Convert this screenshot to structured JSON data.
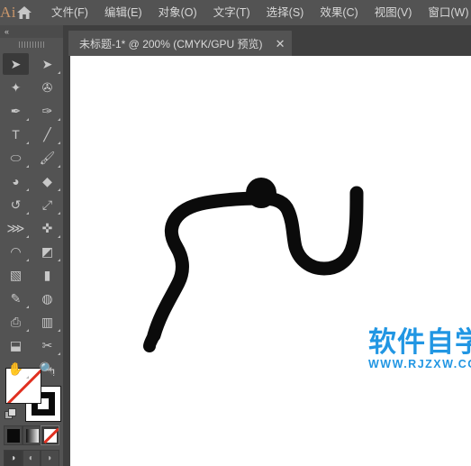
{
  "app": {
    "logo": "Ai",
    "home_icon": "home-icon"
  },
  "menubar": {
    "items": [
      {
        "label": "文件(F)",
        "name": "menu-file"
      },
      {
        "label": "编辑(E)",
        "name": "menu-edit"
      },
      {
        "label": "对象(O)",
        "name": "menu-object"
      },
      {
        "label": "文字(T)",
        "name": "menu-type"
      },
      {
        "label": "选择(S)",
        "name": "menu-select"
      },
      {
        "label": "效果(C)",
        "name": "menu-effect"
      },
      {
        "label": "视图(V)",
        "name": "menu-view"
      },
      {
        "label": "窗口(W)",
        "name": "menu-window"
      }
    ]
  },
  "tabbar": {
    "document_tab": {
      "label": "未标题-1* @ 200% (CMYK/GPU 预览)",
      "close_label": "✕",
      "title": "未标题-1",
      "modified": "*",
      "zoom": "200%",
      "color_mode": "CMYK",
      "preview_mode": "GPU 预览"
    }
  },
  "toolpanel": {
    "collapse_label": "«",
    "grip": "drag-grip",
    "tools": [
      {
        "name": "selection-tool",
        "glyph": "➤",
        "active": true,
        "corner": false
      },
      {
        "name": "direct-selection-tool",
        "glyph": "➤",
        "active": false,
        "corner": true
      },
      {
        "name": "magic-wand-tool",
        "glyph": "✦",
        "active": false,
        "corner": false
      },
      {
        "name": "lasso-tool",
        "glyph": "✇",
        "active": false,
        "corner": false
      },
      {
        "name": "pen-tool",
        "glyph": "✒",
        "active": false,
        "corner": true
      },
      {
        "name": "curvature-tool",
        "glyph": "✑",
        "active": false,
        "corner": true
      },
      {
        "name": "type-tool",
        "glyph": "T",
        "active": false,
        "corner": true
      },
      {
        "name": "line-segment-tool",
        "glyph": "╱",
        "active": false,
        "corner": true
      },
      {
        "name": "ellipse-tool",
        "glyph": "⬭",
        "active": false,
        "corner": true
      },
      {
        "name": "paintbrush-tool",
        "glyph": "🖌",
        "active": false,
        "corner": true
      },
      {
        "name": "shaper-tool",
        "glyph": "◕",
        "active": false,
        "corner": true
      },
      {
        "name": "eraser-tool",
        "glyph": "◆",
        "active": false,
        "corner": true
      },
      {
        "name": "rotate-tool",
        "glyph": "↺",
        "active": false,
        "corner": true
      },
      {
        "name": "scale-tool",
        "glyph": "⤢",
        "active": false,
        "corner": true
      },
      {
        "name": "width-tool",
        "glyph": "⋙",
        "active": false,
        "corner": true
      },
      {
        "name": "free-transform-tool",
        "glyph": "✜",
        "active": false,
        "corner": true
      },
      {
        "name": "shape-builder-tool",
        "glyph": "◠",
        "active": false,
        "corner": true
      },
      {
        "name": "perspective-grid-tool",
        "glyph": "◩",
        "active": false,
        "corner": true
      },
      {
        "name": "mesh-tool",
        "glyph": "▧",
        "active": false,
        "corner": false
      },
      {
        "name": "gradient-tool",
        "glyph": "▮",
        "active": false,
        "corner": false
      },
      {
        "name": "eyedropper-tool",
        "glyph": "✎",
        "active": false,
        "corner": true
      },
      {
        "name": "blend-tool",
        "glyph": "◍",
        "active": false,
        "corner": false
      },
      {
        "name": "symbol-sprayer-tool",
        "glyph": "⎙",
        "active": false,
        "corner": true
      },
      {
        "name": "column-graph-tool",
        "glyph": "▥",
        "active": false,
        "corner": true
      },
      {
        "name": "artboard-tool",
        "glyph": "⬓",
        "active": false,
        "corner": false
      },
      {
        "name": "slice-tool",
        "glyph": "✂",
        "active": false,
        "corner": true
      },
      {
        "name": "hand-tool",
        "glyph": "✋",
        "active": false,
        "corner": true
      },
      {
        "name": "zoom-tool",
        "glyph": "🔍",
        "active": false,
        "corner": false
      }
    ],
    "swatches": {
      "fill": {
        "name": "fill-swatch",
        "value": "none"
      },
      "stroke": {
        "name": "stroke-swatch",
        "value": "#000000"
      },
      "swap_icon": "↰",
      "default_icon": "default-fill-stroke"
    },
    "paint_modes": [
      {
        "name": "color-mode-button",
        "kind": "solid",
        "selected": false
      },
      {
        "name": "gradient-mode-button",
        "kind": "gradient",
        "selected": false
      },
      {
        "name": "none-mode-button",
        "kind": "none",
        "selected": true
      }
    ],
    "screen_modes": [
      {
        "name": "normal-screen-mode-button",
        "glyph": "◑",
        "selected": true
      },
      {
        "name": "full-screen-menubar-mode-button",
        "glyph": "◐",
        "selected": false
      },
      {
        "name": "full-screen-mode-button",
        "glyph": "◗",
        "selected": false
      }
    ]
  },
  "canvas": {
    "artwork_name": "brush-stroke-path",
    "artwork_color": "#0b0b0b",
    "background": "#ffffff"
  },
  "watermark": {
    "chinese": "软件自学网",
    "url": "WWW.RJZXW.COM",
    "color": "#2196e3"
  }
}
